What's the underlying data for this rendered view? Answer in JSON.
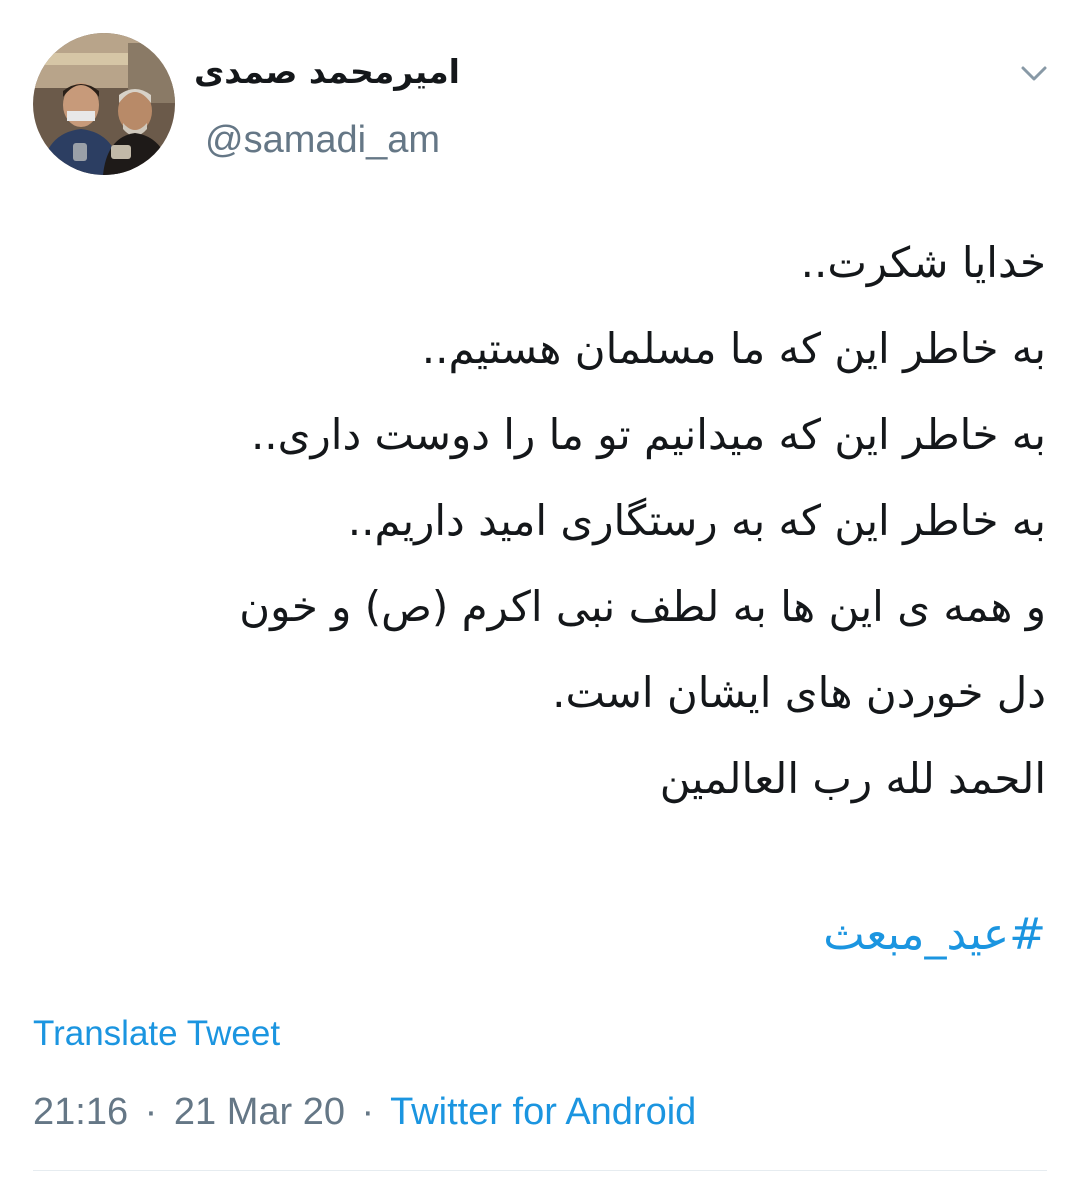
{
  "user": {
    "display_name": "امیرمحمد صمدی",
    "handle": "@samadi_am"
  },
  "icons": {
    "menu": "chevron-down-icon",
    "avatar": "profile-photo"
  },
  "tweet": {
    "lines": [
      "خدایا شکرت..",
      "به خاطر این که ما مسلمان هستیم..",
      "به خاطر این که میدانیم تو ما را دوست داری..",
      "به خاطر این که به رستگاری امید داریم..",
      "و همه ی این ها به لطف نبی اکرم (ص) و خون",
      "دل خوردن های ایشان است.",
      "الحمد لله رب العالمین"
    ],
    "hashtag": "#عید_مبعث"
  },
  "translate_label": "Translate Tweet",
  "meta": {
    "time": "21:16",
    "date": "21 Mar 20",
    "separator": "·",
    "source": "Twitter for Android"
  },
  "colors": {
    "link": "#1b95e0",
    "secondary": "#657786",
    "text": "#14171a",
    "divider": "#e6ecf0"
  }
}
